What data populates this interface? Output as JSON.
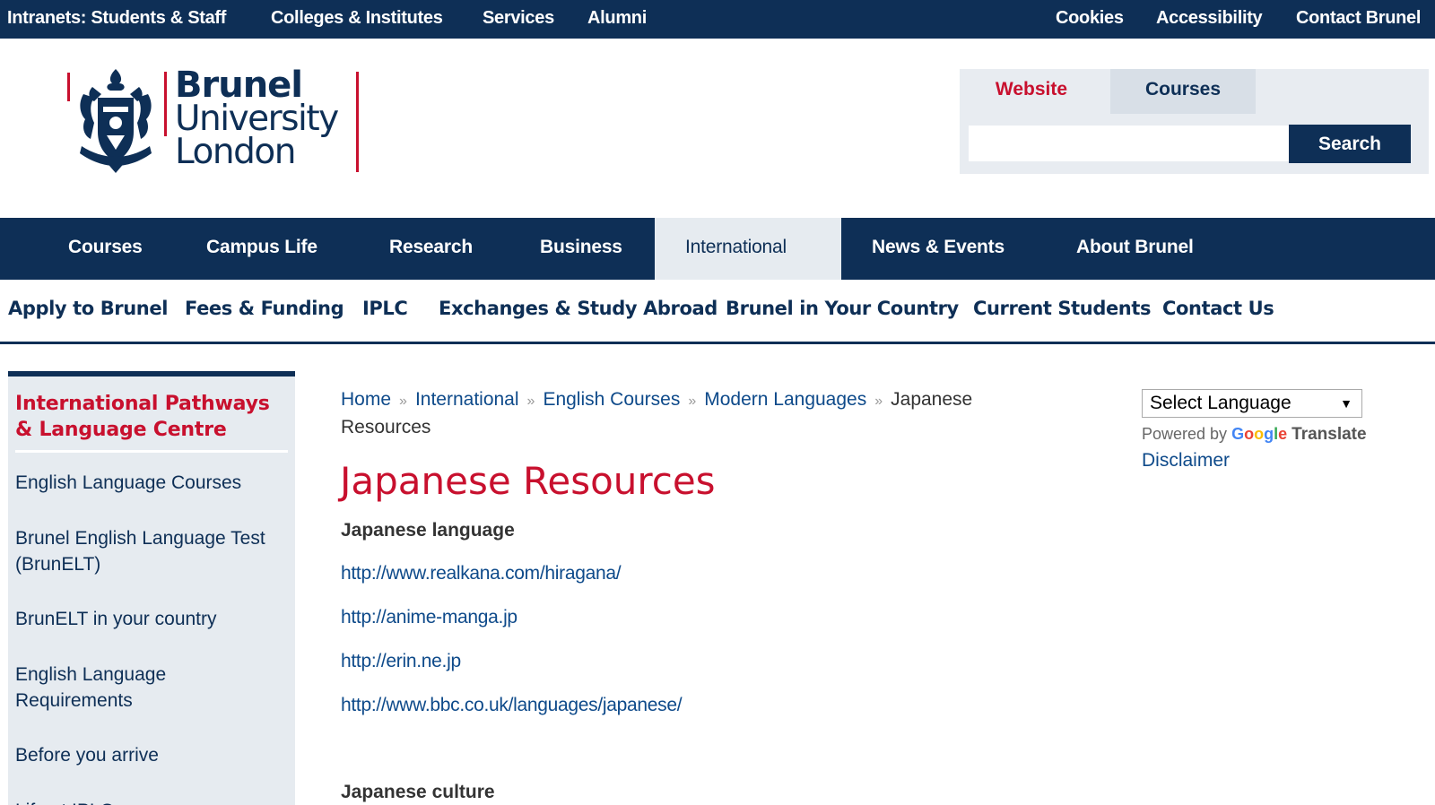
{
  "utility": {
    "intranets": "Intranets: Students & Staff",
    "colleges": "Colleges & Institutes",
    "services": "Services",
    "alumni": "Alumni",
    "cookies": "Cookies",
    "accessibility": "Accessibility",
    "contact": "Contact Brunel"
  },
  "logo": {
    "line1": "Brunel",
    "line2": "University",
    "line3": "London"
  },
  "search": {
    "tab_website": "Website",
    "tab_courses": "Courses",
    "input_value": "",
    "button": "Search"
  },
  "main_nav": {
    "courses": "Courses",
    "campus_life": "Campus Life",
    "research": "Research",
    "business": "Business",
    "international": "International",
    "news_events": "News & Events",
    "about": "About Brunel"
  },
  "sub_nav": {
    "apply": "Apply to Brunel",
    "fees": "Fees & Funding",
    "iplc": "IPLC",
    "exchanges": "Exchanges & Study Abroad",
    "brunel_country": "Brunel in Your Country",
    "current_students": "Current Students",
    "contact_us": "Contact Us"
  },
  "sidebar": {
    "heading": "International Pathways & Language Centre",
    "items": [
      "English Language Courses",
      "Brunel English Language Test (BrunELT)",
      "BrunELT in your country",
      "English Language Requirements",
      "Before you arrive",
      "Life at IPLC"
    ]
  },
  "breadcrumb": {
    "home": "Home",
    "international": "International",
    "english_courses": "English Courses",
    "modern_languages": "Modern Languages",
    "current": "Japanese Resources",
    "sep": "»"
  },
  "page": {
    "title": "Japanese Resources",
    "section1": "Japanese language",
    "links": [
      "http://www.realkana.com/hiragana/",
      "http://anime-manga.jp",
      "http://erin.ne.jp",
      "http://www.bbc.co.uk/languages/japanese/"
    ],
    "section2": "Japanese culture"
  },
  "translate": {
    "select_label": "Select Language",
    "caret": "▼",
    "powered_by": "Powered by",
    "google": "Google",
    "translate": "Translate",
    "disclaimer": "Disclaimer"
  },
  "colors": {
    "navy": "#0e2f56",
    "brunel_red": "#c8102e",
    "link_blue": "#0e4a8a",
    "panel_grey": "#e6ebf0"
  }
}
